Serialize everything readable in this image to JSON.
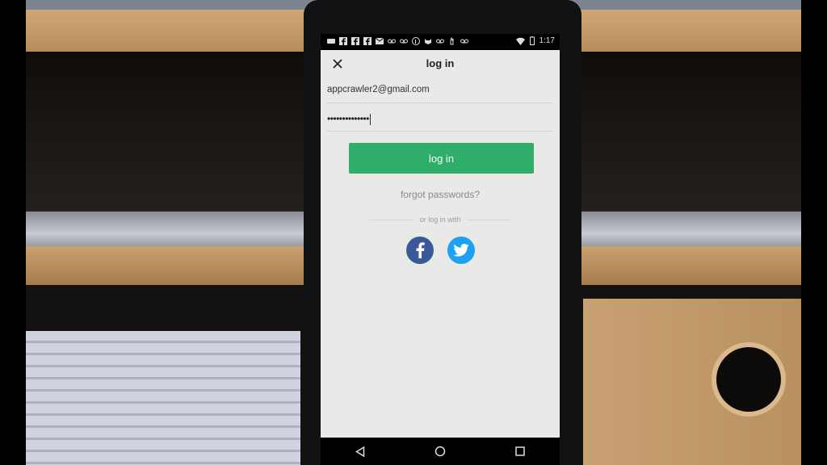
{
  "status_bar": {
    "time": "1:17",
    "icons": [
      "message-icon",
      "facebook-icon",
      "facebook-icon",
      "facebook-icon",
      "gmail-icon",
      "voicemail-icon",
      "voicemail-icon",
      "pinterest-icon",
      "mask-icon",
      "voicemail-icon",
      "hand-icon",
      "voicemail-icon",
      "wifi-icon",
      "battery-icon"
    ]
  },
  "app": {
    "title": "log in",
    "email_value": "appcrawler2@gmail.com",
    "password_value": "••••••••••••••",
    "login_button": "log in",
    "forgot_link": "forgot passwords?",
    "or_text": "or log in with",
    "social": [
      "facebook-icon",
      "twitter-icon"
    ],
    "colors": {
      "login_green": "#2fae6a",
      "facebook_blue": "#3b5998",
      "twitter_blue": "#1da1f2"
    }
  },
  "nav": [
    "back-icon",
    "home-icon",
    "recents-icon"
  ]
}
